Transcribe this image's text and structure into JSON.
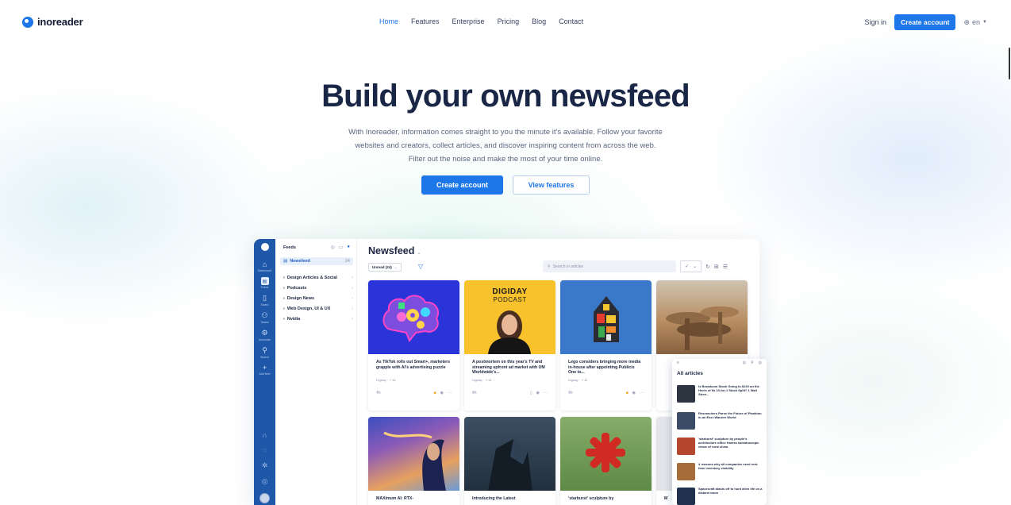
{
  "brand": {
    "name": "inoreader"
  },
  "nav": {
    "links": [
      {
        "label": "Home",
        "active": true
      },
      {
        "label": "Features"
      },
      {
        "label": "Enterprise"
      },
      {
        "label": "Pricing"
      },
      {
        "label": "Blog"
      },
      {
        "label": "Contact"
      }
    ],
    "sign_in": "Sign in",
    "create_account": "Create account",
    "lang": "en"
  },
  "hero": {
    "title": "Build your own newsfeed",
    "subtitle": "With Inoreader, information comes straight to you the minute it's available. Follow your favorite websites and creators, collect articles, and discover inspiring content from across the web. Filter out the noise and make the most of your time online.",
    "primary_cta": "Create account",
    "secondary_cta": "View features"
  },
  "app": {
    "rail": [
      {
        "label": "Dashboard",
        "icon": "home-icon"
      },
      {
        "label": "Feeds",
        "icon": "feeds-icon",
        "active": true
      },
      {
        "label": "Saved",
        "icon": "bookmark-icon"
      },
      {
        "label": "Teams",
        "icon": "teams-icon"
      },
      {
        "label": "Automate",
        "icon": "automate-icon"
      },
      {
        "label": "Search",
        "icon": "search-icon"
      },
      {
        "label": "Add feed",
        "icon": "plus-icon"
      }
    ],
    "feeds": {
      "title": "Feeds",
      "active": {
        "label": "Newsfeed",
        "count": "24"
      },
      "items": [
        {
          "label": "Design Articles & Social"
        },
        {
          "label": "Podcasts"
        },
        {
          "label": "Design News"
        },
        {
          "label": "Web Design, UI & UX"
        },
        {
          "label": "Nvidia"
        }
      ]
    },
    "main": {
      "title": "Newsfeed",
      "unread": "Unread (24)",
      "search_placeholder": "Search in articles",
      "cards": [
        {
          "title": "As TikTok rolls out Smart+, marketers grapple with AI's advertising puzzle",
          "source": "Digiday",
          "time": "4h",
          "image": "tiktok"
        },
        {
          "title": "A postmortem on this year's TV and streaming upfront ad market with UM Worldwide's...",
          "source": "Digiday",
          "time": "4h",
          "image": "digiday",
          "image_text_1": "DIGIDAY",
          "image_text_2": "PODCAST"
        },
        {
          "title": "Lego considers bringing more media in-house after appointing Publicis One to...",
          "source": "Digiday",
          "time": "4h",
          "image": "lego"
        },
        {
          "title": "",
          "source": "",
          "time": "",
          "image": "arch"
        },
        {
          "title": "MAXimum AI: RTX-",
          "image": "anime"
        },
        {
          "title": "Introducing the Latest",
          "image": "rtx"
        },
        {
          "title": "'starburst' sculpture by",
          "image": "star"
        },
        {
          "title": "M",
          "image": "grey"
        }
      ]
    },
    "panel": {
      "title": "All articles",
      "items": [
        {
          "title": "Is Broadcom Stock Going to $220 on the Heels of Its 10-for-1 Stock Split? 1 Wall Stree...",
          "thumb": "#2c3440"
        },
        {
          "title": "Researchers Parse the Future of Plankton in an Ever-Warmer World",
          "thumb": "#3b4d66"
        },
        {
          "title": "'starburst' sculpture by people's architecture office frames kaleidoscopic views of rural china",
          "thumb": "#b5472f"
        },
        {
          "title": "4 reasons why all companies need real-time inventory visibility",
          "thumb": "#a66d3a"
        },
        {
          "title": "Spacecraft blasts off to hunt alien life on a distant moon",
          "thumb": "#20324f"
        }
      ]
    }
  }
}
